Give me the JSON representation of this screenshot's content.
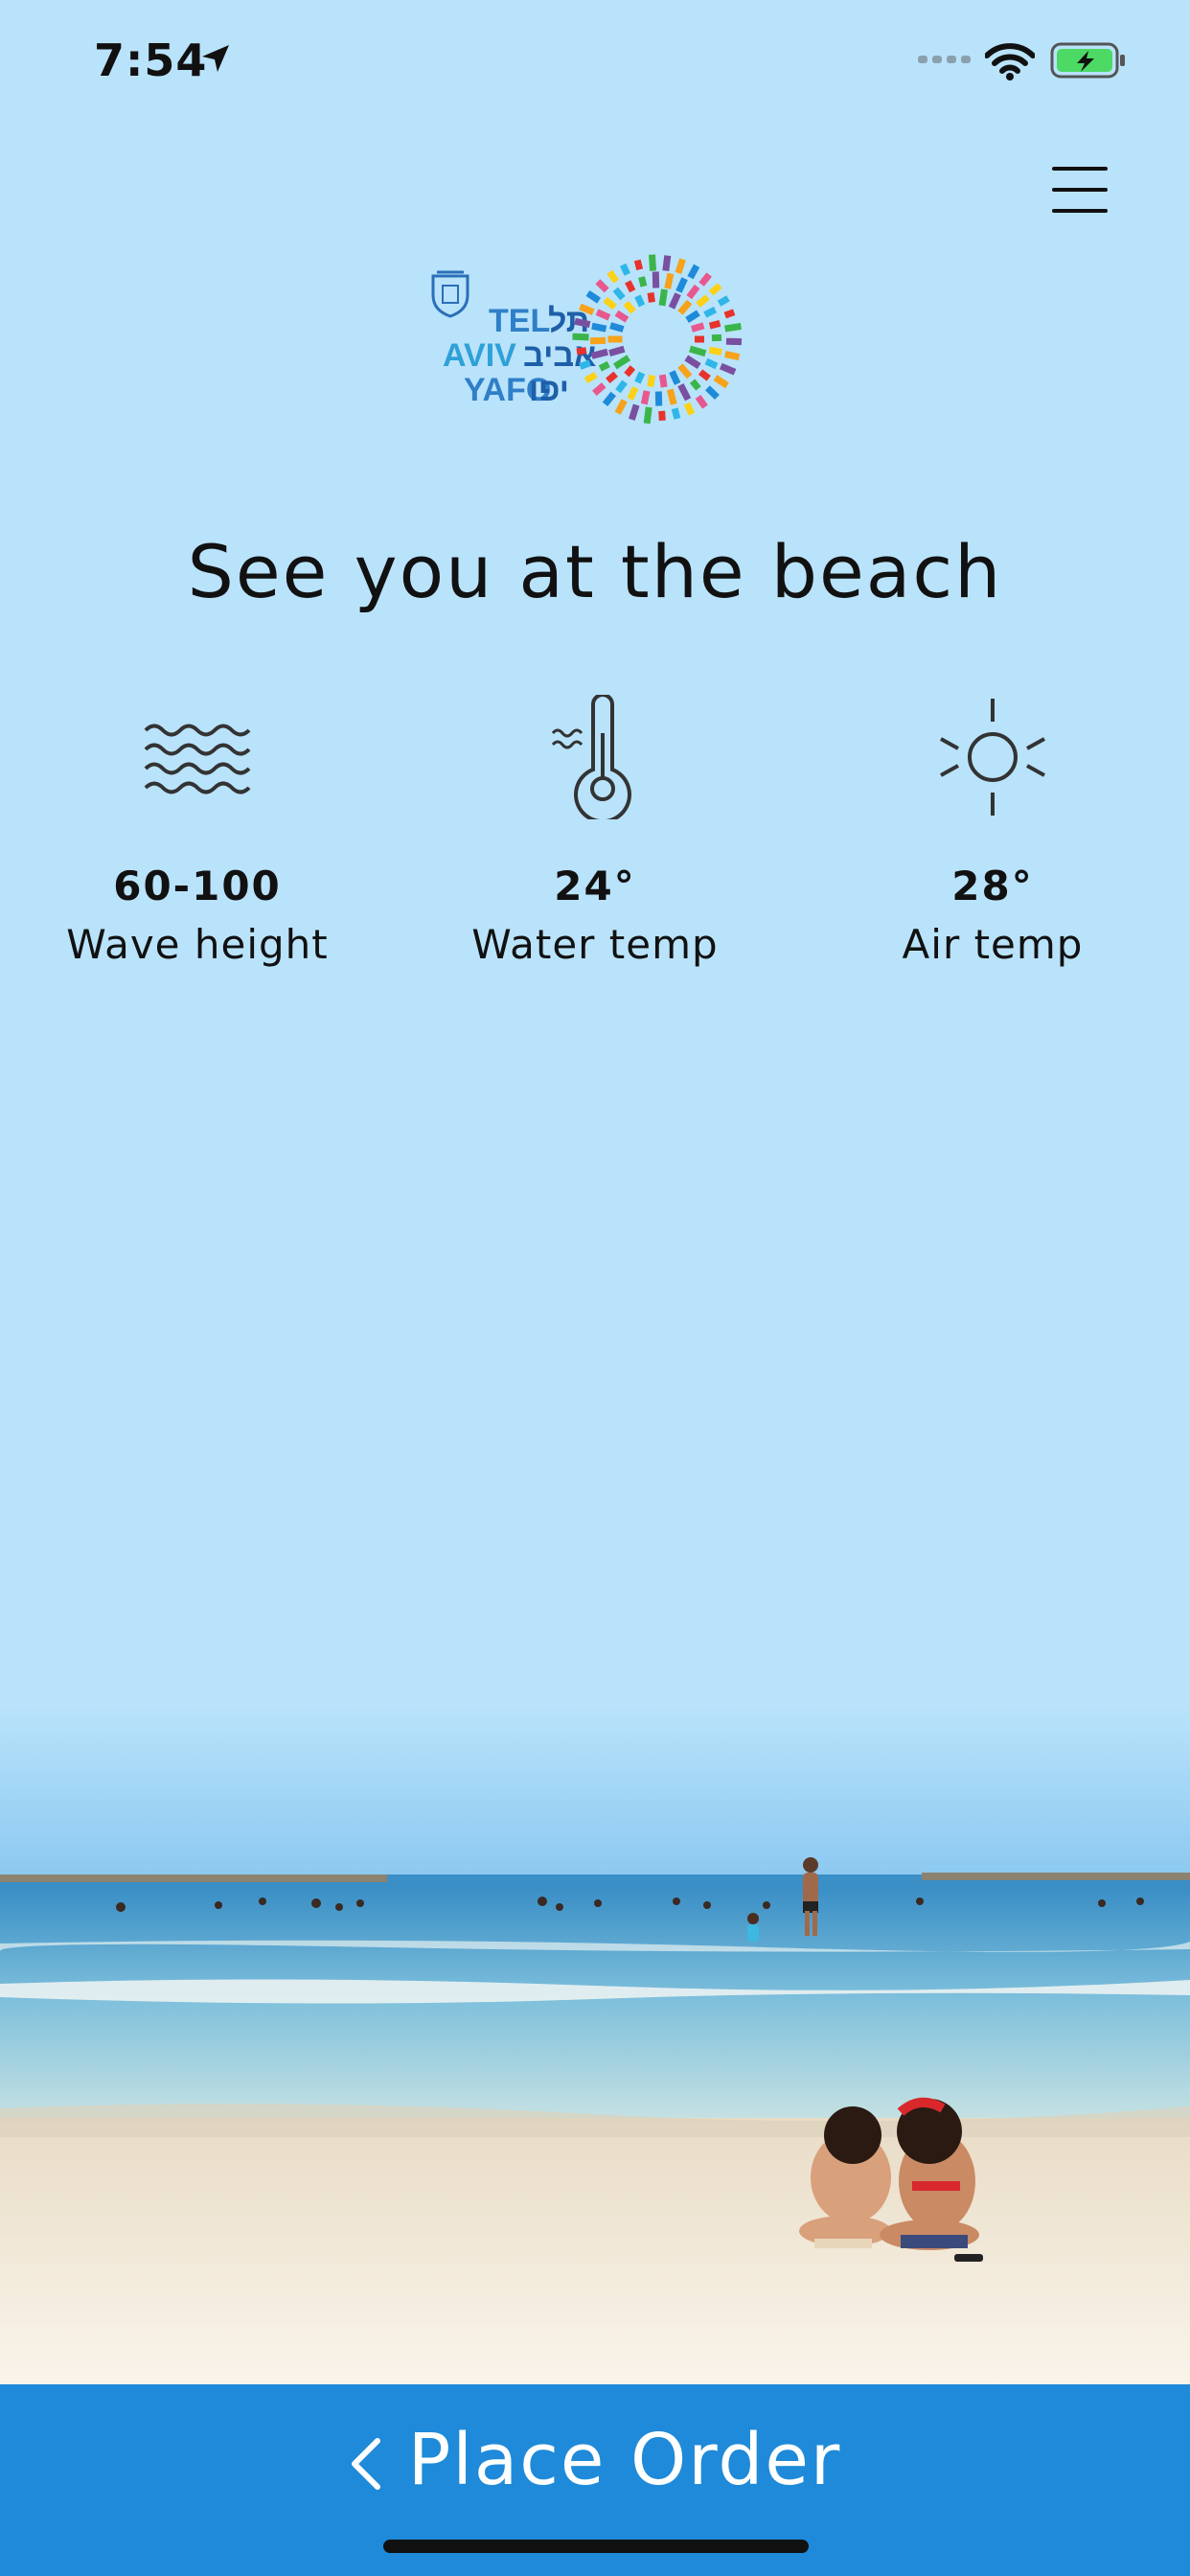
{
  "status_bar": {
    "time": "7:54",
    "icons": [
      "location-arrow-icon",
      "signal-icon",
      "wifi-icon",
      "battery-charging-icon"
    ],
    "battery_color": "#4cd964"
  },
  "header": {
    "menu_icon": "hamburger-menu-icon",
    "logo": {
      "en": [
        "TEL",
        "AVIV",
        "YAFO"
      ],
      "he": [
        "תל",
        "אביב",
        "יפו"
      ]
    }
  },
  "main": {
    "headline": "See you at the beach",
    "stats": [
      {
        "icon": "waves-icon",
        "value": "60-100",
        "label": "Wave height"
      },
      {
        "icon": "thermometer-icon",
        "value": "24°",
        "label": "Water temp"
      },
      {
        "icon": "sun-icon",
        "value": "28°",
        "label": "Air temp"
      }
    ]
  },
  "footer": {
    "order_label": "Place Order",
    "chevron_icon": "chevron-left-icon",
    "accent_color": "#1e8ad9"
  }
}
